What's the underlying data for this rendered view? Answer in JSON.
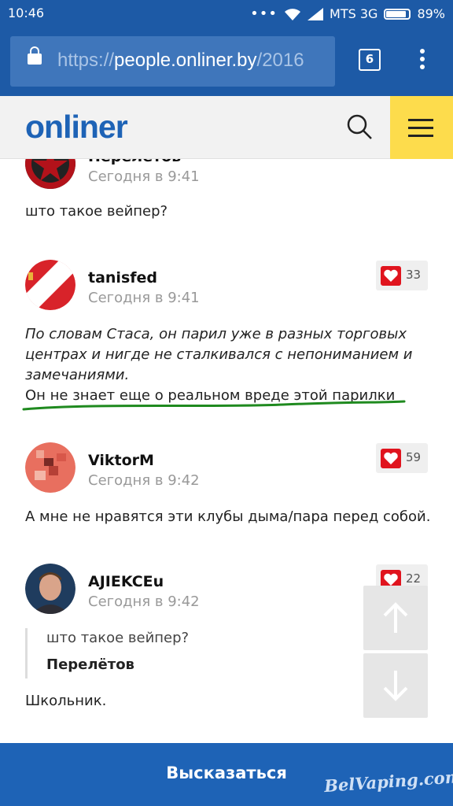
{
  "status_bar": {
    "time": "10:46",
    "carrier": "MTS 3G",
    "battery": "89%"
  },
  "browser": {
    "url_scheme": "https://",
    "url_host": "people.onliner.by",
    "url_path": "/2016",
    "tab_count": "6"
  },
  "site": {
    "logo": "onliner"
  },
  "comments": [
    {
      "author": "Перелётов",
      "time": "Сегодня в 9:41",
      "text": "што такое вейпер?"
    },
    {
      "author": "tanisfed",
      "time": "Сегодня в 9:41",
      "likes": "33",
      "quote_italic": "По словам Стаса, он парил уже в разных торговых центрах и нигде не сталкивался с непониманием и замечаниями.",
      "text": "Он не знает еще о реальном вреде этой парилки"
    },
    {
      "author": "ViktorM",
      "time": "Сегодня в 9:42",
      "likes": "59",
      "text": "А мне не нравятся эти клубы дыма/пара перед собой."
    },
    {
      "author": "AJIEKCEu",
      "time": "Сегодня в 9:42",
      "likes": "22",
      "quote_text": "што такое вейпер?",
      "quote_author": "Перелётов",
      "text": "Школьник."
    }
  ],
  "bottom_bar": {
    "button_label": "Высказаться"
  },
  "watermark": "BelVaping.com",
  "colors": {
    "brand_blue": "#1e63b6",
    "menu_yellow": "#fddc4c",
    "like_red": "#e0141e",
    "underline_green": "#1f8a1f"
  }
}
